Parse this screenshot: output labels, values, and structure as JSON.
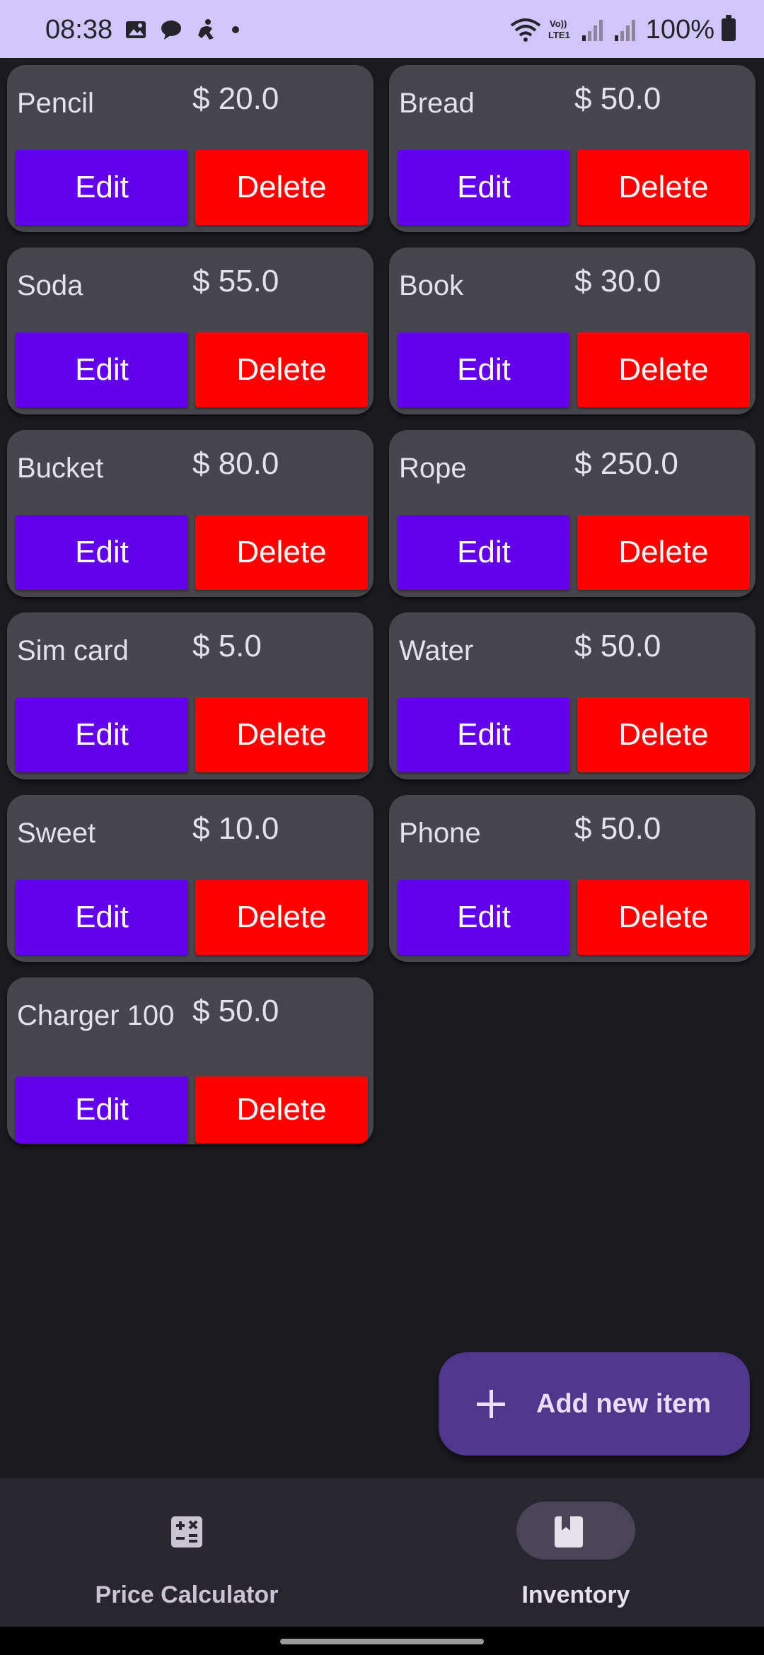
{
  "status_bar": {
    "time": "08:38",
    "battery": "100%",
    "icons": [
      "gallery-icon",
      "chat-icon",
      "accessibility-icon",
      "dot-icon",
      "wifi-icon",
      "volte-icon",
      "signal-icon",
      "signal-icon",
      "battery-icon"
    ]
  },
  "items": [
    {
      "name": "Pencil",
      "price": "$ 20.0"
    },
    {
      "name": "Bread",
      "price": "$ 50.0"
    },
    {
      "name": "Soda",
      "price": "$ 55.0"
    },
    {
      "name": "Book",
      "price": "$ 30.0"
    },
    {
      "name": "Bucket",
      "price": "$ 80.0"
    },
    {
      "name": "Rope",
      "price": "$ 250.0"
    },
    {
      "name": "Sim card",
      "price": "$ 5.0"
    },
    {
      "name": "Water",
      "price": "$ 50.0"
    },
    {
      "name": "Sweet",
      "price": "$ 10.0"
    },
    {
      "name": "Phone",
      "price": "$ 50.0"
    },
    {
      "name": "Charger 100",
      "price": "$ 50.0"
    }
  ],
  "labels": {
    "edit": "Edit",
    "delete": "Delete",
    "fab": "Add new item"
  },
  "bottom_nav": {
    "items": [
      {
        "label": "Price Calculator",
        "icon": "calculator-icon",
        "selected": false
      },
      {
        "label": "Inventory",
        "icon": "book-icon",
        "selected": true
      }
    ]
  },
  "colors": {
    "edit": "#6200ee",
    "delete": "#ff0000",
    "card": "#48464d",
    "background": "#1c1b20",
    "status_bar": "#d0c6fb",
    "fab": "#4f378b"
  }
}
